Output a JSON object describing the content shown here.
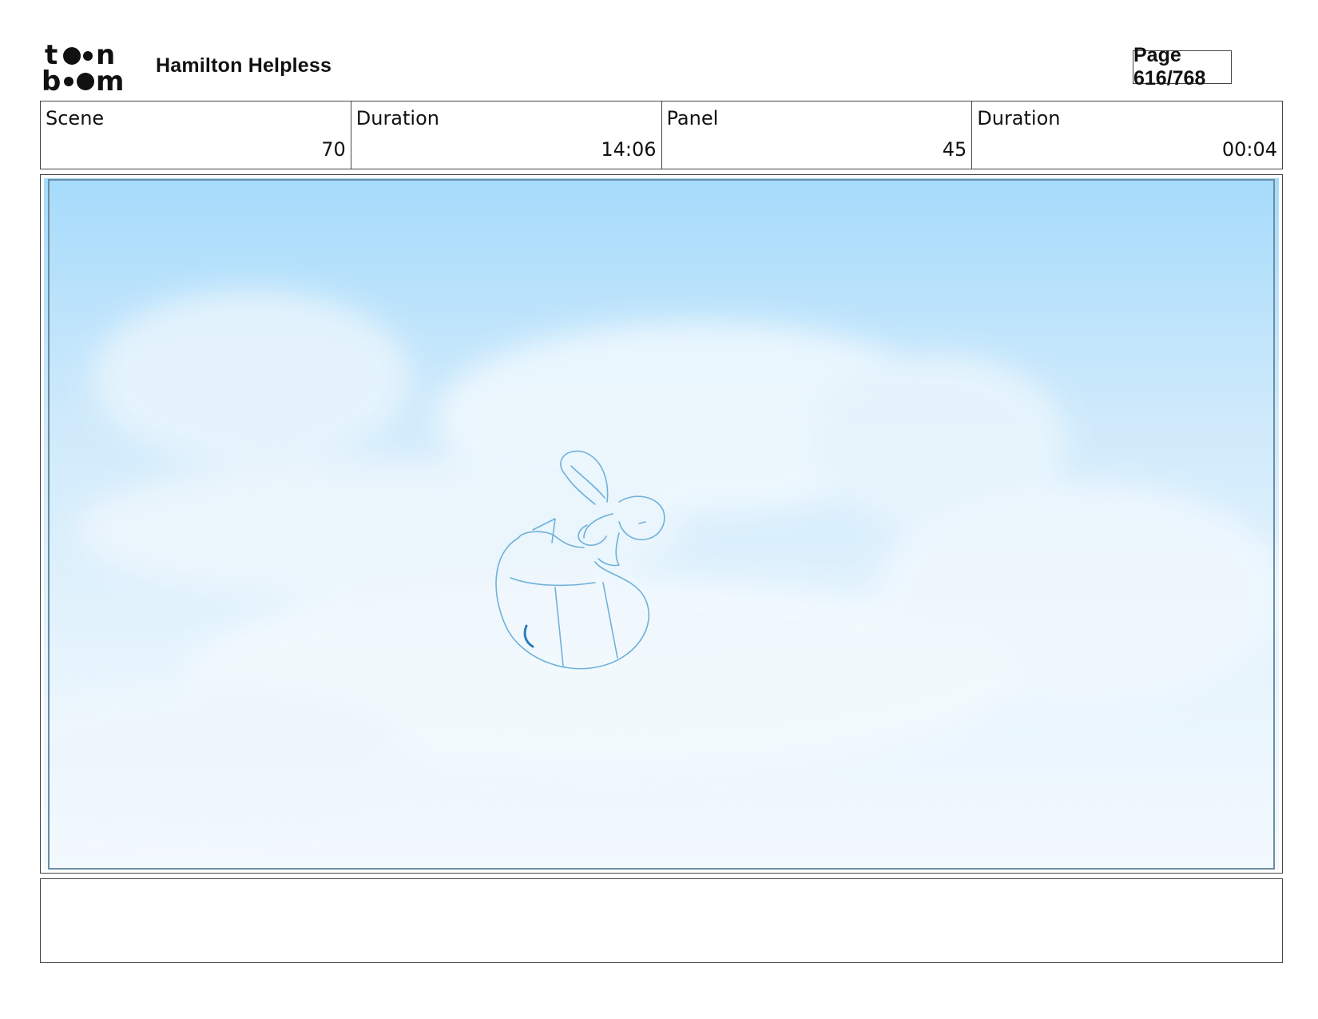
{
  "header": {
    "logo_text": "toon boom",
    "project_title": "Hamilton Helpless",
    "page_label": "Page 616/768"
  },
  "info": [
    {
      "label": "Scene",
      "value": "70"
    },
    {
      "label": "Duration",
      "value": "14:06"
    },
    {
      "label": "Panel",
      "value": "45"
    },
    {
      "label": "Duration",
      "value": "00:04"
    }
  ],
  "panel": {
    "description_colors": {
      "sky_top": "#a7dcfb",
      "sky_bottom": "#f2f9fe",
      "sketch_line": "#5aa8d6"
    }
  },
  "notes": {
    "text": ""
  }
}
